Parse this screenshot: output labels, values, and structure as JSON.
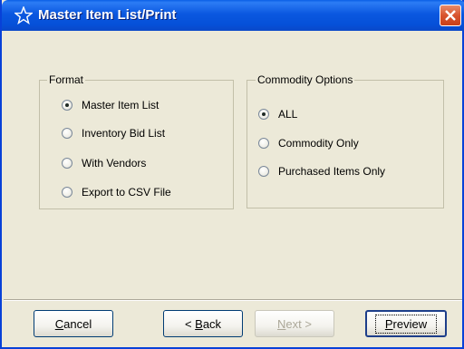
{
  "window": {
    "title": "Master Item List/Print"
  },
  "format_group": {
    "legend": "Format",
    "options": [
      {
        "label": "Master Item List",
        "checked": true
      },
      {
        "label": "Inventory Bid List",
        "checked": false
      },
      {
        "label": "With Vendors",
        "checked": false
      },
      {
        "label": "Export to CSV File",
        "checked": false
      }
    ]
  },
  "commodity_group": {
    "legend": "Commodity Options",
    "options": [
      {
        "label": "ALL",
        "checked": true
      },
      {
        "label": "Commodity Only",
        "checked": false
      },
      {
        "label": "Purchased Items Only",
        "checked": false
      }
    ]
  },
  "buttons": {
    "cancel": {
      "accel": "C",
      "rest": "ancel"
    },
    "back": {
      "pre": "< ",
      "accel": "B",
      "rest": "ack"
    },
    "next": {
      "accel": "N",
      "rest": "ext >"
    },
    "preview": {
      "accel": "P",
      "rest": "review"
    }
  },
  "colors": {
    "titlebar": "#0A5FE6",
    "background": "#ECE9D8",
    "close": "#D8542E"
  }
}
